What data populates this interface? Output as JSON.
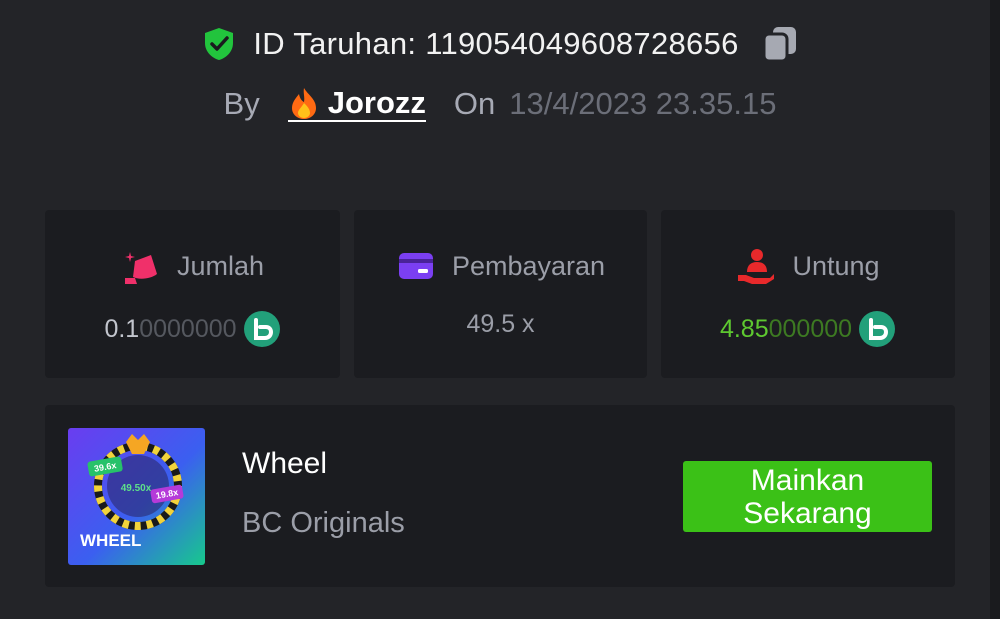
{
  "header": {
    "bet_id": "ID Taruhan: 119054049608728656",
    "by_label": "By",
    "username": "Jorozz",
    "on_label": "On",
    "date": "13/4/2023 23.35.15"
  },
  "stats": {
    "amount": {
      "label": "Jumlah",
      "value_main": "0.1",
      "value_rest": "0000000"
    },
    "payout": {
      "label": "Pembayaran",
      "value": "49.5 x"
    },
    "profit": {
      "label": "Untung",
      "value_main": "4.85",
      "value_rest": "000000"
    }
  },
  "game": {
    "name": "Wheel",
    "provider": "BC Originals",
    "play_button": "Mainkan Sekarang",
    "thumb_label": "WHEEL",
    "thumb_mult_1": "39.6x",
    "thumb_mult_2": "49.50x",
    "thumb_mult_3": "19.8x"
  },
  "colors": {
    "background": "#232428",
    "card": "#1b1c20",
    "accent_green": "#3bc117",
    "profit_green": "#5ec930",
    "coin_green": "#22a07a"
  },
  "icons": {
    "verified": "shield-check-icon",
    "copy": "copy-icon",
    "user": "fire-icon",
    "amount": "money-bag-icon",
    "payout": "card-icon",
    "profit": "hand-user-icon",
    "coin": "bc-coin-icon"
  }
}
